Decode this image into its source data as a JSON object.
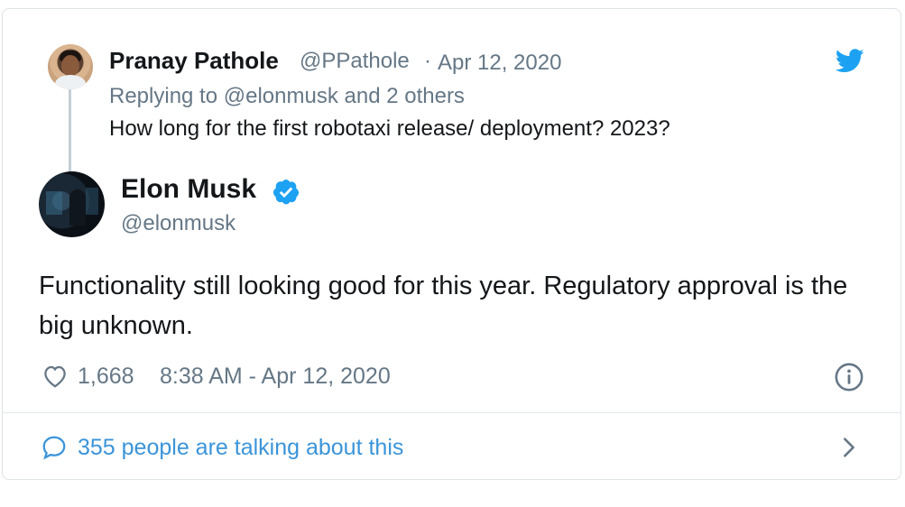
{
  "reply_tweet": {
    "author_name": "Pranay Pathole",
    "author_handle": "@PPathole",
    "separator": "·",
    "date": "Apr 12, 2020",
    "replying_prefix": "Replying to",
    "replying_mention": "@elonmusk",
    "replying_suffix": "and 2 others",
    "text": "How long for the first robotaxi release/ deployment? 2023?"
  },
  "main_tweet": {
    "author_name": "Elon Musk",
    "author_handle": "@elonmusk",
    "verified_icon": "verified-badge-icon",
    "text": "Functionality still looking good for this year. Regulatory approval is the big unknown.",
    "like_count": "1,668",
    "timestamp": "8:38 AM - Apr 12, 2020"
  },
  "footer": {
    "talking_text": "355 people are talking about this"
  },
  "icons": {
    "brand": "twitter-bird-icon",
    "like": "heart-icon",
    "info": "info-icon",
    "comment": "speech-bubble-icon",
    "chevron": "chevron-right-icon"
  },
  "colors": {
    "brand_blue": "#1da1f2",
    "link_blue": "#3b94d9",
    "muted_gray": "#657786",
    "text_dark": "#14171a"
  }
}
